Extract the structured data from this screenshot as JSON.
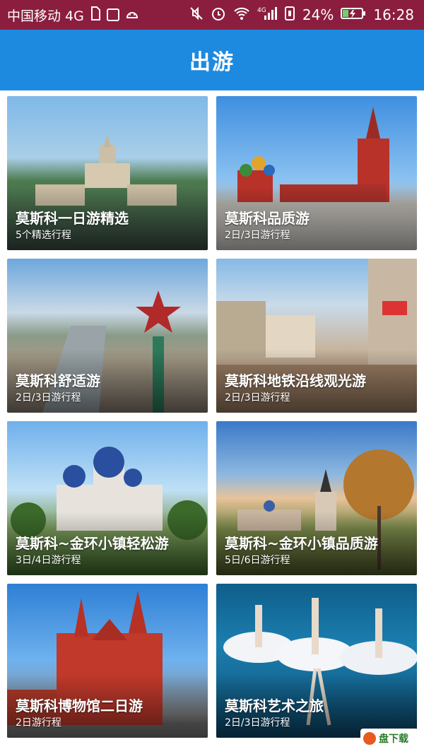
{
  "status_bar": {
    "carrier": "中国移动 4G",
    "battery": "24%",
    "time": "16:28",
    "network": "4G"
  },
  "app_bar": {
    "title": "出游"
  },
  "cards": [
    {
      "title": "莫斯科一日游精选",
      "subtitle": "5个精选行程"
    },
    {
      "title": "莫斯科品质游",
      "subtitle": "2日/3日游行程"
    },
    {
      "title": "莫斯科舒适游",
      "subtitle": "2日/3日游行程"
    },
    {
      "title": "莫斯科地铁沿线观光游",
      "subtitle": "2日/3日游行程"
    },
    {
      "title": "莫斯科~金环小镇轻松游",
      "subtitle": "3日/4日游行程"
    },
    {
      "title": "莫斯科~金环小镇品质游",
      "subtitle": "5日/6日游行程"
    },
    {
      "title": "莫斯科博物馆二日游",
      "subtitle": "2日游行程"
    },
    {
      "title": "莫斯科艺术之旅",
      "subtitle": "2日/3日游行程"
    }
  ],
  "watermark": {
    "text": "盘下载"
  },
  "colors": {
    "status_bar": "#8b1e3f",
    "app_bar": "#1d8ae0"
  }
}
